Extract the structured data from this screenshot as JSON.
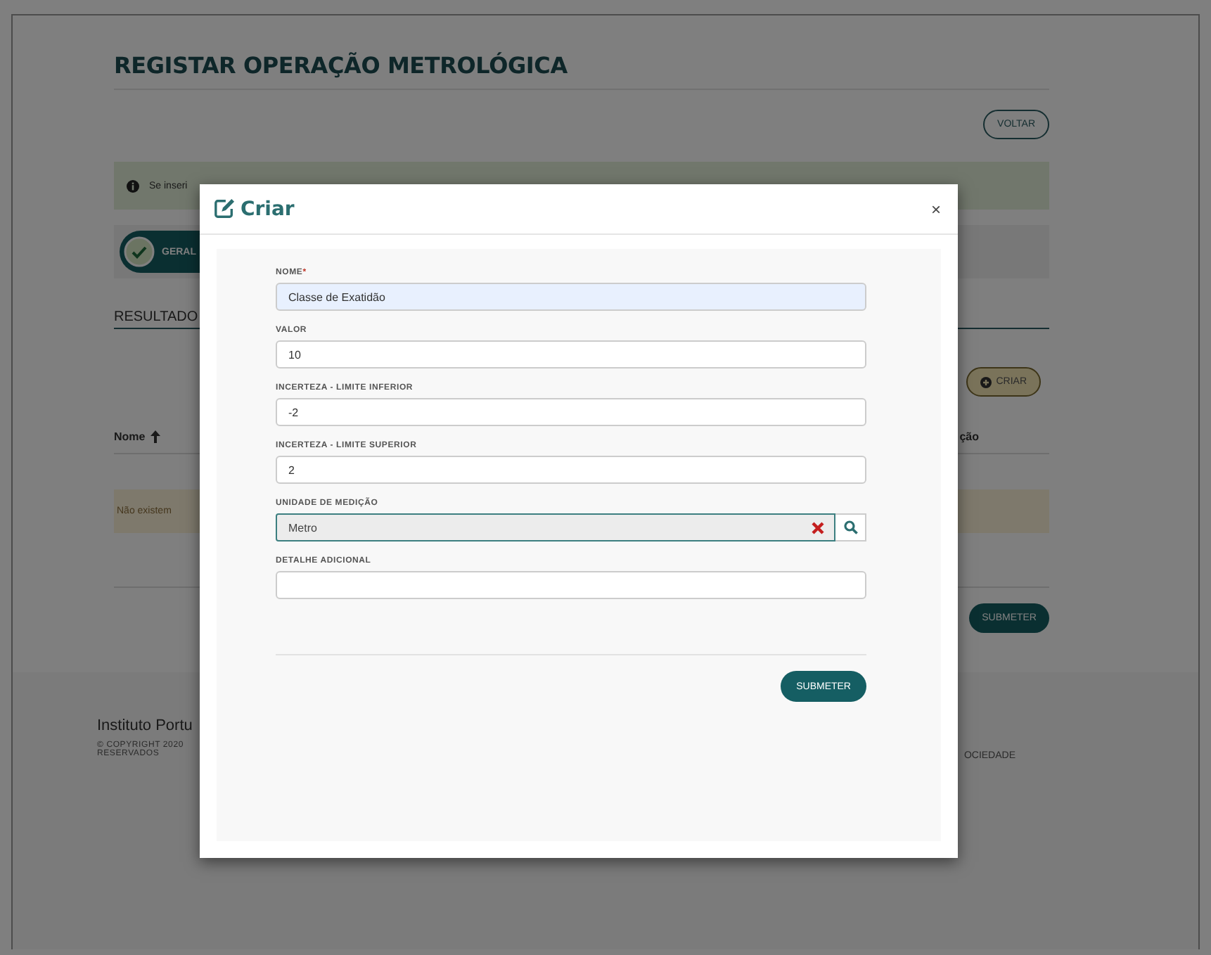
{
  "page": {
    "title": "REGISTAR OPERAÇÃO METROLÓGICA",
    "back_button": "VOLTAR",
    "alert": "Se inseri",
    "tabs": [
      {
        "label": "GERAL",
        "selected": true
      }
    ],
    "section_title": "RESULTADO",
    "create_button": "CRIAR",
    "table": {
      "columns": [
        {
          "label": "Nome",
          "sorted": true
        },
        {
          "label": "ção",
          "sorted": false
        }
      ]
    },
    "empty_message": "Não existem",
    "submit_button": "SUBMETER"
  },
  "footer": {
    "organization": "Instituto Portu",
    "copyright": [
      "© COPYRIGHT 2020",
      "RESERVADOS"
    ],
    "column_2": "OCIEDADE"
  },
  "modal": {
    "title": "Criar",
    "close": "×",
    "fields": [
      {
        "kind": "text",
        "label": "NOME",
        "required_mark": "*",
        "value": "Classe de Exatidão",
        "autofilled": true
      },
      {
        "kind": "text",
        "label": "VALOR",
        "value": "10",
        "autofilled": false
      },
      {
        "kind": "text",
        "label": "INCERTEZA - LIMITE INFERIOR",
        "value": "-2",
        "autofilled": false
      },
      {
        "kind": "text",
        "label": "INCERTEZA - LIMITE SUPERIOR",
        "value": "2",
        "autofilled": false
      },
      {
        "kind": "lookup",
        "label": "UNIDADE DE MEDIÇÃO",
        "value": "Metro"
      },
      {
        "kind": "text",
        "label": "DETALHE ADICIONAL",
        "autofilled": false
      }
    ],
    "submit": "SUBMETER"
  }
}
